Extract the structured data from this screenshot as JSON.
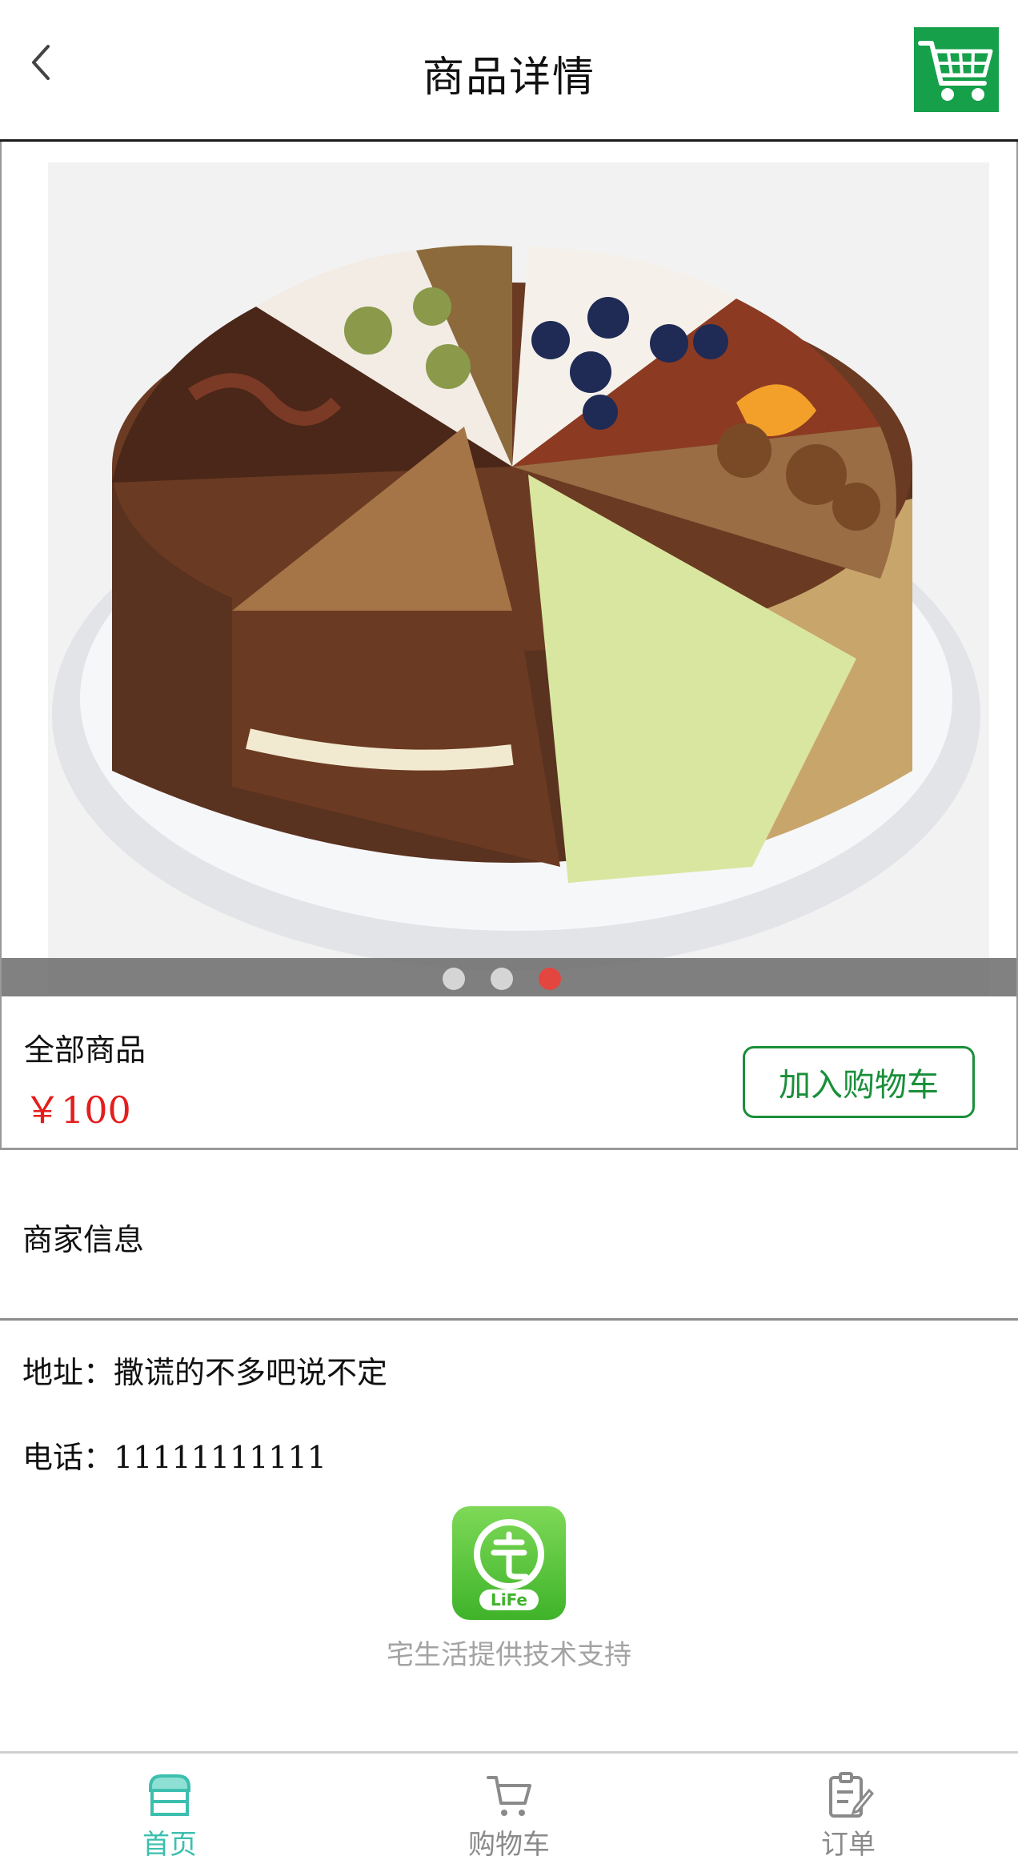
{
  "header": {
    "title": "商品详情",
    "back_icon": "chevron-left-icon",
    "cart_icon": "shopping-cart-icon",
    "cart_color": "#16a04a"
  },
  "carousel": {
    "slide_count": 3,
    "active_index": 2,
    "dot_color": "#d5d5d5",
    "active_dot_color": "#e2463f",
    "image_desc_icon": "cake-image"
  },
  "product": {
    "name": "全部商品",
    "price": "￥100",
    "price_color": "#e41d1d",
    "add_to_cart_label": "加入购物车",
    "accent_color": "#1a8f3a"
  },
  "merchant": {
    "section_title": "商家信息",
    "address": "地址：撒谎的不多吧说不定",
    "phone": "电话：11111111111"
  },
  "footer": {
    "logo_icon": "zhai-life-logo",
    "powered_by": "宅生活提供技术支持"
  },
  "tabbar": {
    "active_color": "#3cbfae",
    "tabs": [
      {
        "label": "首页",
        "icon": "store-icon",
        "active": true
      },
      {
        "label": "购物车",
        "icon": "cart-icon",
        "active": false
      },
      {
        "label": "订单",
        "icon": "order-icon",
        "active": false
      }
    ]
  }
}
